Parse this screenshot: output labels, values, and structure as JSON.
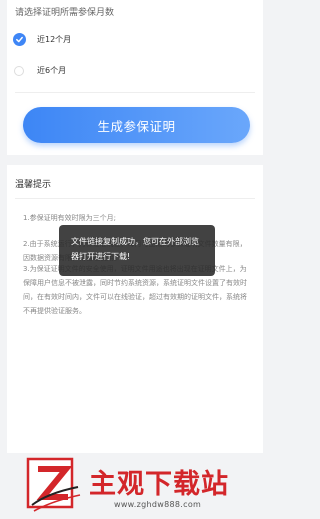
{
  "months": {
    "title": "请选择证明所需参保月数",
    "options": [
      {
        "label": "近12个月",
        "selected": true
      },
      {
        "label": "近6个月",
        "selected": false
      }
    ]
  },
  "generate_button": {
    "label": "生成参保证明"
  },
  "tips": {
    "title": "温馨提示",
    "items": [
      "1.参保证明有效时限为三个月;",
      "2.由于系统运行，为保证准确性，每月可生成的参保证明文件数量有限，因数据资源有限，请合理使用。",
      "3.为保证证明文件的安全使用，证明文件用途也将出现在证明文件上，为保障用户信息不被泄露，同时节约系统资源，系统证明文件设置了有效时间，在有效时间内，文件可以在线验证，超过有效期的证明文件，系统将不再提供验证服务。"
    ]
  },
  "toast": {
    "message": "文件链接复制成功，您可在外部浏览器打开进行下载!"
  },
  "watermark": {
    "text": "主观下载站",
    "url": "www.zghdw888.com"
  },
  "colors": {
    "accent": "#3f86f6",
    "watermark": "#d3262a"
  }
}
